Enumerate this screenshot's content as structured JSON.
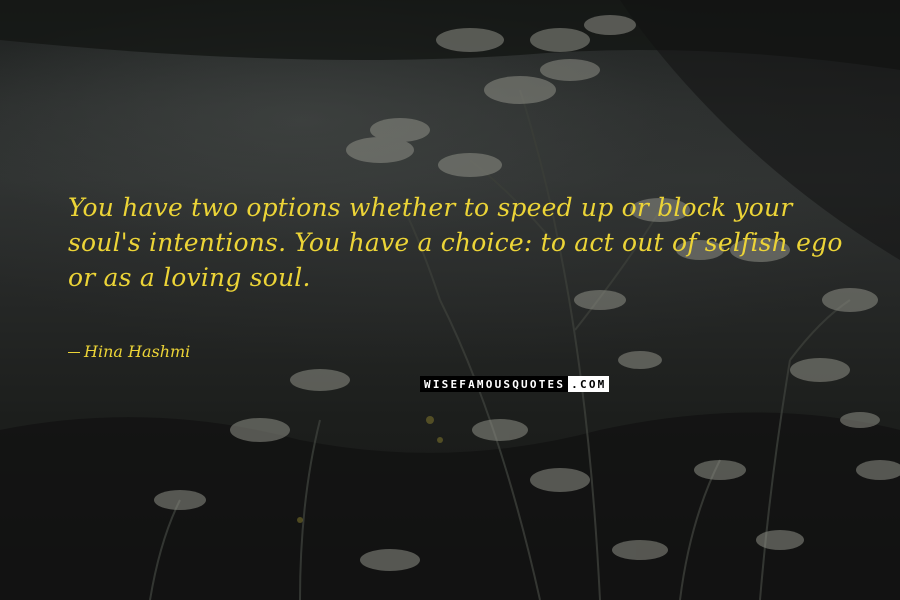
{
  "quote": {
    "text": "You have two options whether to speed up or block your soul's intentions. You have a choice: to act out of selfish ego or as a loving soul.",
    "author": "Hina Hashmi"
  },
  "watermark": {
    "part1": "WISEFAMOUSQUOTES",
    "part2": ".COM"
  },
  "colors": {
    "text": "#ecd437"
  }
}
